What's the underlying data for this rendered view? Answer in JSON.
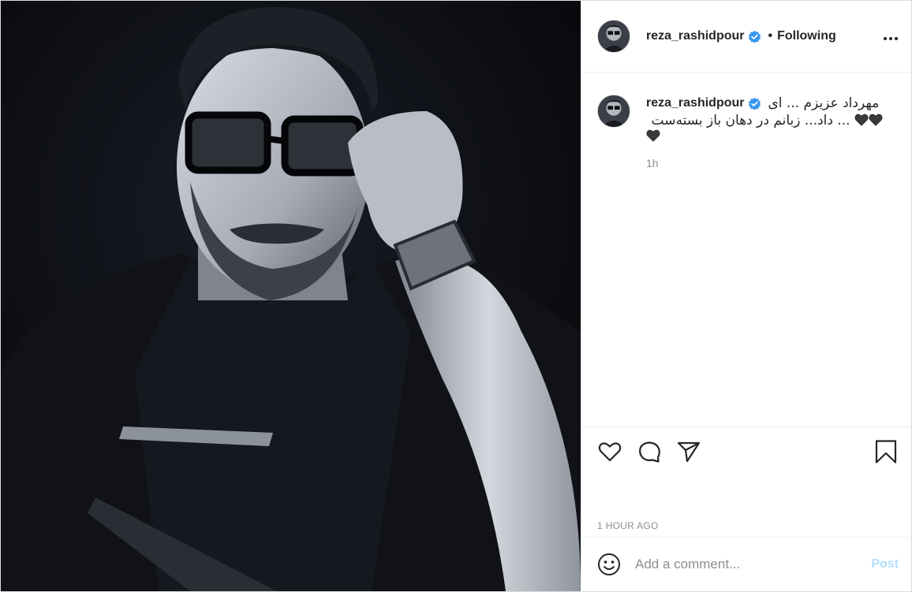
{
  "post": {
    "image_alt": "",
    "author": {
      "username": "reza_rashidpour",
      "verified": true
    },
    "header": {
      "separator": "•",
      "follow_status": "Following",
      "more_icon": "more-options-icon"
    },
    "caption": {
      "username": "reza_rashidpour",
      "text_line1": "مهرداد عزیزم ... ای",
      "text_line2": "... داد... زبانم در دهان باز بسته‌ست",
      "relative_time": "1h"
    },
    "actions": {
      "like_icon": "heart-icon",
      "comment_icon": "comment-icon",
      "share_icon": "share-icon",
      "save_icon": "bookmark-icon"
    },
    "timestamp": "1 HOUR AGO",
    "add_comment": {
      "emoji_icon": "emoji-icon",
      "placeholder": "Add a comment...",
      "post_label": "Post"
    },
    "colors": {
      "verified_blue": "#3897f0",
      "post_button_disabled": "#b2dffc",
      "secondary_text": "#8e8e8e"
    }
  }
}
